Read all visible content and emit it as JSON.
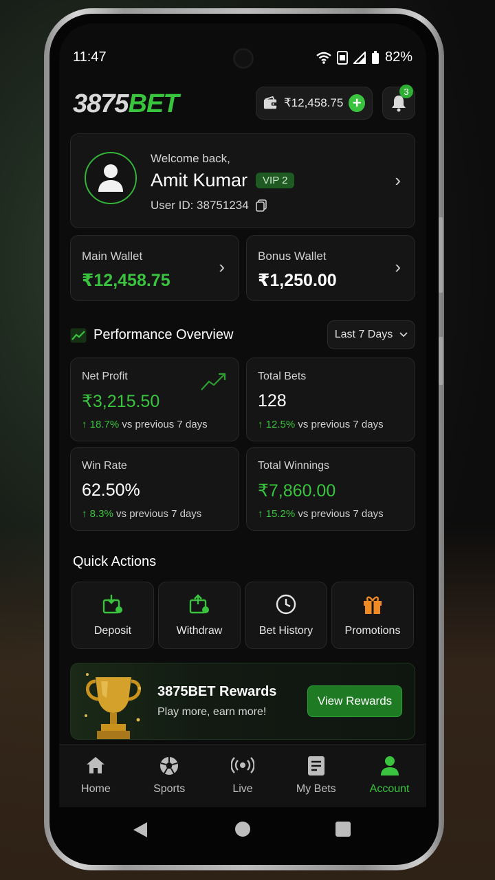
{
  "status_bar": {
    "time": "11:47",
    "battery": "82%"
  },
  "header": {
    "logo_number": "3875",
    "logo_brand": "BET",
    "wallet_balance": "₹12,458.75",
    "notification_count": "3"
  },
  "profile": {
    "welcome": "Welcome back,",
    "name": "Amit Kumar",
    "vip": "VIP 2",
    "user_id": "User ID: 38751234"
  },
  "wallets": {
    "main_label": "Main Wallet",
    "main_value": "₹12,458.75",
    "bonus_label": "Bonus Wallet",
    "bonus_value": "₹1,250.00"
  },
  "performance": {
    "title": "Performance Overview",
    "range": "Last 7 Days",
    "stats": [
      {
        "label": "Net Profit",
        "value": "₹3,215.50",
        "change": "18.7%",
        "suffix": " vs previous 7 days"
      },
      {
        "label": "Total Bets",
        "value": "128",
        "change": "12.5%",
        "suffix": " vs previous 7 days"
      },
      {
        "label": "Win Rate",
        "value": "62.50%",
        "change": "8.3%",
        "suffix": " vs previous 7 days"
      },
      {
        "label": "Total Winnings",
        "value": "₹7,860.00",
        "change": "15.2%",
        "suffix": " vs previous 7 days"
      }
    ]
  },
  "quick_actions": {
    "title": "Quick Actions",
    "items": [
      {
        "label": "Deposit",
        "icon": "deposit-icon"
      },
      {
        "label": "Withdraw",
        "icon": "withdraw-icon"
      },
      {
        "label": "Bet History",
        "icon": "clock-icon"
      },
      {
        "label": "Promotions",
        "icon": "gift-icon"
      }
    ]
  },
  "rewards": {
    "title": "3875BET Rewards",
    "subtitle": "Play more, earn more!",
    "button": "View Rewards"
  },
  "tabs": [
    {
      "label": "Home",
      "icon": "home-icon"
    },
    {
      "label": "Sports",
      "icon": "soccer-ball-icon"
    },
    {
      "label": "Live",
      "icon": "live-broadcast-icon"
    },
    {
      "label": "My Bets",
      "icon": "betslip-icon"
    },
    {
      "label": "Account",
      "icon": "user-icon",
      "active": true
    }
  ],
  "colors": {
    "accent": "#3ac33e",
    "background": "#0b0c0b",
    "card": "#141514",
    "orange": "#f08a24"
  }
}
